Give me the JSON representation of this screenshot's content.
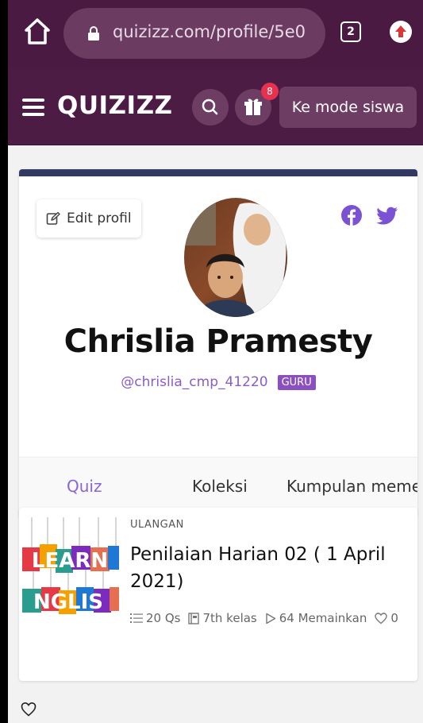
{
  "browser": {
    "url": "quizizz.com/profile/5e0",
    "tab_count": "2"
  },
  "header": {
    "logo": "QUIZIZZ",
    "gift_badge_count": "8",
    "student_mode_label": "Ke mode siswa"
  },
  "profile": {
    "edit_label": "Edit profil",
    "name": "Chrislia Pramesty",
    "handle": "@chrislia_cmp_41220",
    "role_badge": "GURU"
  },
  "tabs": [
    {
      "label": "Quiz",
      "active": true
    },
    {
      "label": "Koleksi",
      "active": false
    },
    {
      "label": "Kumpulan meme",
      "active": false
    }
  ],
  "quiz": {
    "type": "ULANGAN",
    "title": "Penilaian Harian 02 ( 1 April 2021)",
    "questions": "20 Qs",
    "grade": "7th kelas",
    "plays": "64 Memainkan",
    "likes": "0",
    "thumb_text_line1": "LEARN",
    "thumb_text_line2": "NGLIS"
  },
  "colors": {
    "header_bg": "#4d1c44",
    "accent_purple": "#8a64d6",
    "badge_red": "#e8304f",
    "badge_purple": "#8b4fbf"
  }
}
